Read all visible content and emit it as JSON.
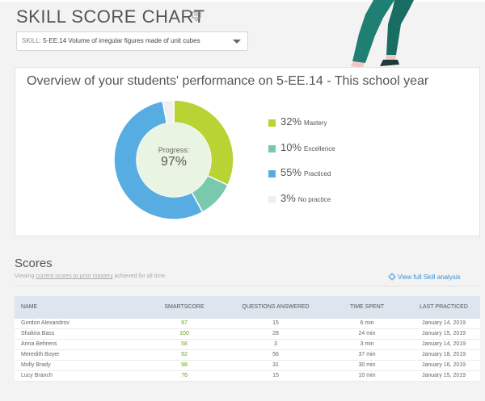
{
  "page": {
    "title": "SKILL SCORE CHART"
  },
  "skill_select": {
    "prefix": "SKILL:",
    "value": "5-EE.14 Volume of irregular figures made of unit cubes"
  },
  "overview": {
    "title": "Overview of your students' performance on 5-EE.14 - This school year",
    "progress_label": "Progress:",
    "progress_value": "97%"
  },
  "legend": [
    {
      "pct": "32%",
      "name": "Mastery",
      "color": "#b8d333"
    },
    {
      "pct": "10%",
      "name": "Excellence",
      "color": "#79c9ad"
    },
    {
      "pct": "55%",
      "name": "Practiced",
      "color": "#57ade1"
    },
    {
      "pct": "3%",
      "name": "No practice",
      "color": "#f0f0f0"
    }
  ],
  "chart_data": {
    "type": "pie",
    "categories": [
      "Mastery",
      "Excellence",
      "Practiced",
      "No practice"
    ],
    "values": [
      32,
      10,
      55,
      3
    ],
    "colors": [
      "#b8d333",
      "#79c9ad",
      "#57ade1",
      "#f0f0f0"
    ],
    "center_label": "Progress:",
    "center_value": "97%"
  },
  "scores": {
    "title": "Scores",
    "subtitle_pre": "Viewing ",
    "subtitle_link": "current scores or prior mastery",
    "subtitle_post": " achieved for all time.",
    "analysis_link": "View full Skill analysis",
    "columns": [
      "NAME",
      "SMARTSCORE",
      "QUESTIONS ANSWERED",
      "TIME SPENT",
      "LAST PRACTICED"
    ],
    "rows": [
      {
        "name": "Gordon Alexandrov",
        "score": "97",
        "questions": "15",
        "time": "6 min",
        "last": "January 14, 2019"
      },
      {
        "name": "Shakira Bass",
        "score": "100",
        "questions": "28",
        "time": "24 min",
        "last": "January 15, 2019"
      },
      {
        "name": "Anna Behrens",
        "score": "58",
        "questions": "3",
        "time": "3 min",
        "last": "January 14, 2019"
      },
      {
        "name": "Meredith Boyer",
        "score": "92",
        "questions": "56",
        "time": "37 min",
        "last": "January 18, 2019"
      },
      {
        "name": "Molly Brady",
        "score": "98",
        "questions": "31",
        "time": "30 min",
        "last": "January 16, 2019"
      },
      {
        "name": "Lucy Branch",
        "score": "76",
        "questions": "15",
        "time": "10 min",
        "last": "January 15, 2019"
      }
    ]
  }
}
